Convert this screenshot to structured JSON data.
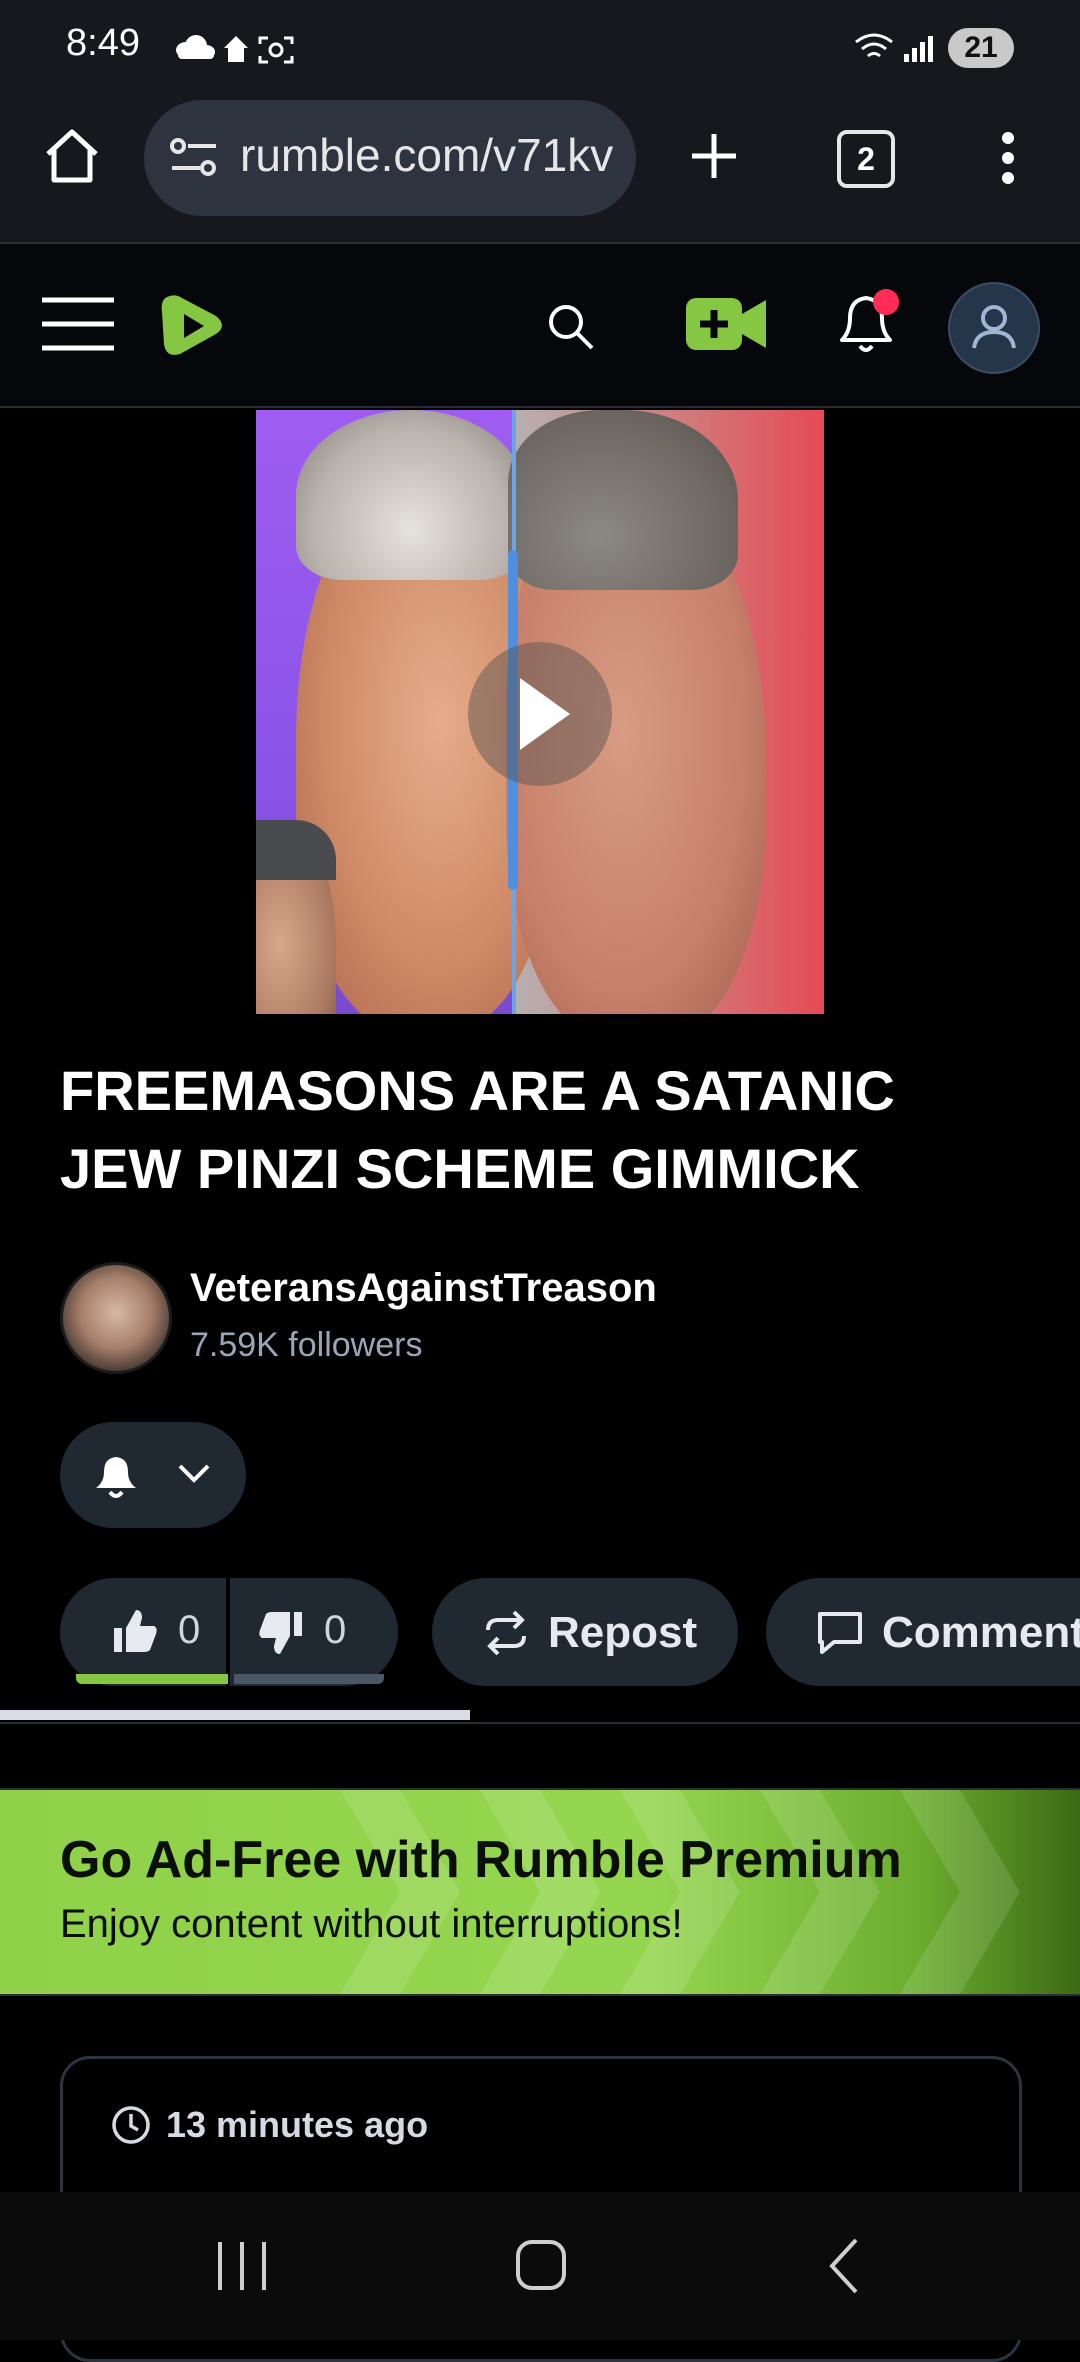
{
  "status_bar": {
    "time": "8:49",
    "battery": "21"
  },
  "browser": {
    "url": "rumble.com/v71kv",
    "tab_count": "2"
  },
  "video": {
    "title": "FREEMASONS ARE A SATANIC JEW PINZI SCHEME GIMMICK",
    "channel_name": "VeteransAgainstTreason",
    "followers": "7.59K followers",
    "likes": "0",
    "dislikes": "0",
    "like_ratio": 1.0
  },
  "actions": {
    "repost_label": "Repost",
    "comment_label": "Comment"
  },
  "banner": {
    "title": "Go Ad-Free with Rumble Premium",
    "subtitle": "Enjoy content without interruptions!"
  },
  "description_card": {
    "time_ago": "13 minutes ago"
  },
  "colors": {
    "rumble_green": "#85c742",
    "notification_dot": "#ff2d55",
    "pill_bg": "#202832"
  }
}
